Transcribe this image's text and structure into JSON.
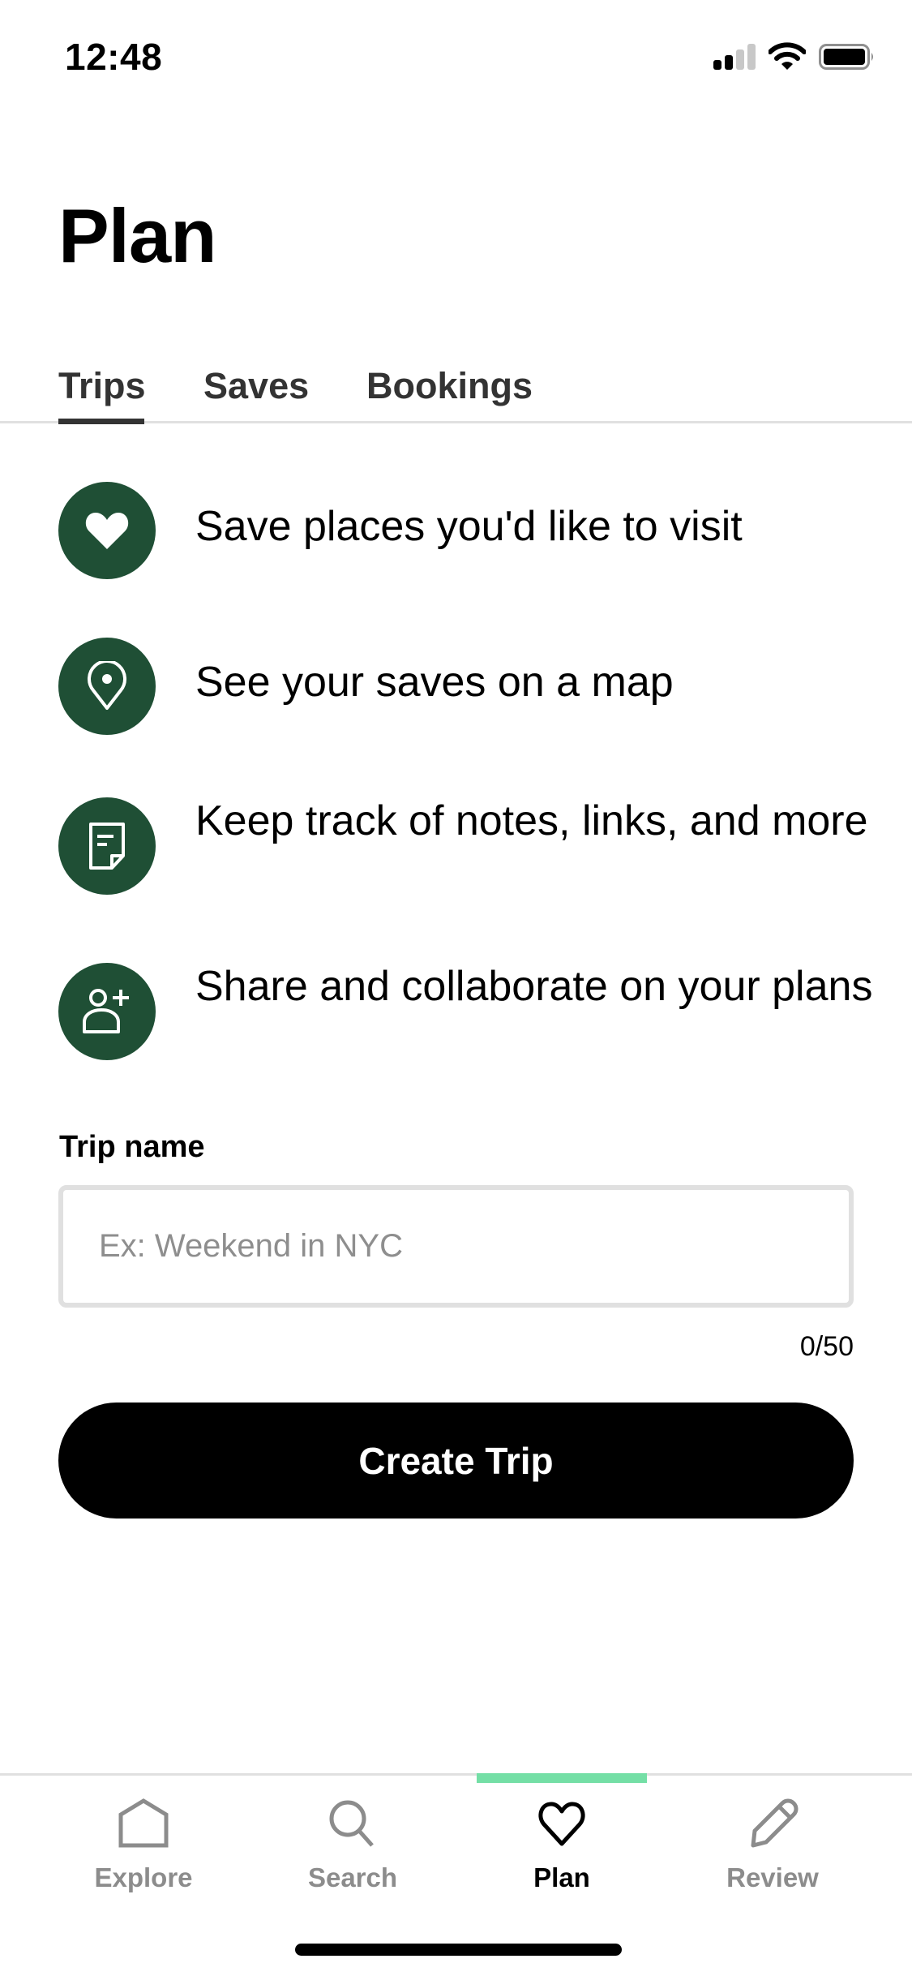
{
  "status_bar": {
    "time": "12:48",
    "signal_bars_active": 2,
    "signal_bars_total": 4,
    "wifi": "wifi-icon",
    "battery": "battery-icon"
  },
  "header": {
    "title": "Plan"
  },
  "tabs": [
    {
      "label": "Trips",
      "active": true
    },
    {
      "label": "Saves",
      "active": false
    },
    {
      "label": "Bookings",
      "active": false
    }
  ],
  "features": [
    {
      "icon": "heart-icon",
      "text": "Save places you'd like to visit"
    },
    {
      "icon": "map-pin-icon",
      "text": "See your saves on a map"
    },
    {
      "icon": "note-icon",
      "text": "Keep track of notes, links, and more"
    },
    {
      "icon": "add-person-icon",
      "text": "Share and collaborate on your plans"
    }
  ],
  "form": {
    "label": "Trip name",
    "value": "",
    "placeholder": "Ex: Weekend in NYC",
    "char_count": "0/50",
    "submit_label": "Create Trip"
  },
  "bottom_nav": [
    {
      "label": "Explore",
      "icon": "home-icon",
      "active": false
    },
    {
      "label": "Search",
      "icon": "search-icon",
      "active": false
    },
    {
      "label": "Plan",
      "icon": "heart-outline-icon",
      "active": true
    },
    {
      "label": "Review",
      "icon": "pencil-icon",
      "active": false
    }
  ],
  "colors": {
    "brand_dark_green": "#1f4f35",
    "nav_active_indicator": "#74dfa6",
    "inactive_gray": "#8c8c8c",
    "tab_text": "#333333",
    "divider": "#e0e0e0"
  }
}
